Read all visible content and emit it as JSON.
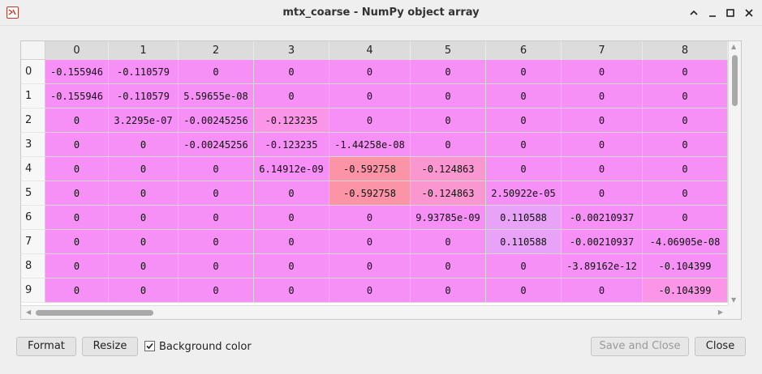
{
  "window": {
    "title": "mtx_coarse - NumPy object array",
    "app_icon": "spyder-app-icon",
    "controls": [
      "chevron-up-icon",
      "minimize-icon",
      "maximize-icon",
      "close-icon"
    ]
  },
  "table": {
    "columns": [
      "0",
      "1",
      "2",
      "3",
      "4",
      "5",
      "6",
      "7",
      "8"
    ],
    "row_labels": [
      "0",
      "1",
      "2",
      "3",
      "4",
      "5",
      "6",
      "7",
      "8",
      "9"
    ],
    "rows": [
      [
        "-0.155946",
        "-0.110579",
        "0",
        "0",
        "0",
        "0",
        "0",
        "0",
        "0"
      ],
      [
        "-0.155946",
        "-0.110579",
        "5.59655e-08",
        "0",
        "0",
        "0",
        "0",
        "0",
        "0"
      ],
      [
        "0",
        "3.2295e-07",
        "-0.00245256",
        "-0.123235",
        "0",
        "0",
        "0",
        "0",
        "0"
      ],
      [
        "0",
        "0",
        "-0.00245256",
        "-0.123235",
        "-1.44258e-08",
        "0",
        "0",
        "0",
        "0"
      ],
      [
        "0",
        "0",
        "0",
        "6.14912e-09",
        "-0.592758",
        "-0.124863",
        "0",
        "0",
        "0"
      ],
      [
        "0",
        "0",
        "0",
        "0",
        "-0.592758",
        "-0.124863",
        "2.50922e-05",
        "0",
        "0"
      ],
      [
        "0",
        "0",
        "0",
        "0",
        "0",
        "9.93785e-09",
        "0.110588",
        "-0.00210937",
        "0"
      ],
      [
        "0",
        "0",
        "0",
        "0",
        "0",
        "0",
        "0.110588",
        "-0.00210937",
        "-4.06905e-08"
      ],
      [
        "0",
        "0",
        "0",
        "0",
        "0",
        "0",
        "0",
        "-3.89162e-12",
        "-0.104399"
      ],
      [
        "0",
        "0",
        "0",
        "0",
        "0",
        "0",
        "0",
        "0",
        "-0.104399"
      ]
    ],
    "colors": {
      "base": "#f68ff6",
      "light": "#fb95e8",
      "mid": "#fa96d0",
      "strong": "#fc94a8",
      "blue": "#e8a2f7"
    }
  },
  "buttons": {
    "format": "Format",
    "resize": "Resize",
    "background_color_label": "Background color",
    "background_color_checked": true,
    "save_and_close": "Save and Close",
    "close": "Close"
  }
}
